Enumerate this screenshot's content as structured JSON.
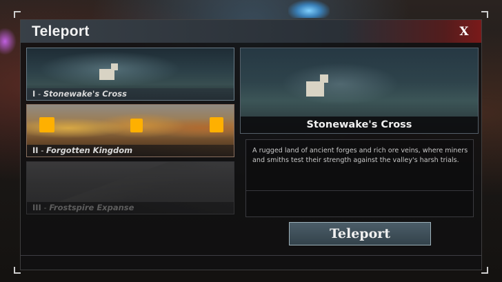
{
  "dialog": {
    "title": "Teleport",
    "close_label": "X"
  },
  "locations": [
    {
      "numeral": "I",
      "separator": "-",
      "name": "Stonewake's Cross",
      "selected": true
    },
    {
      "numeral": "II",
      "separator": "-",
      "name": "Forgotten Kingdom",
      "selected": false
    },
    {
      "numeral": "III",
      "separator": "-",
      "name": "Frostspire Expanse",
      "locked": true
    }
  ],
  "detail": {
    "name": "Stonewake's Cross",
    "description": "A rugged land of ancient forges and rich ore veins, where miners and smiths test their strength against the valley's harsh trials."
  },
  "action": {
    "teleport_label": "Teleport"
  },
  "colors": {
    "title_accent": "#7a1a1a",
    "panel_bg": "#101012",
    "button_border": "#9eb1ba"
  }
}
